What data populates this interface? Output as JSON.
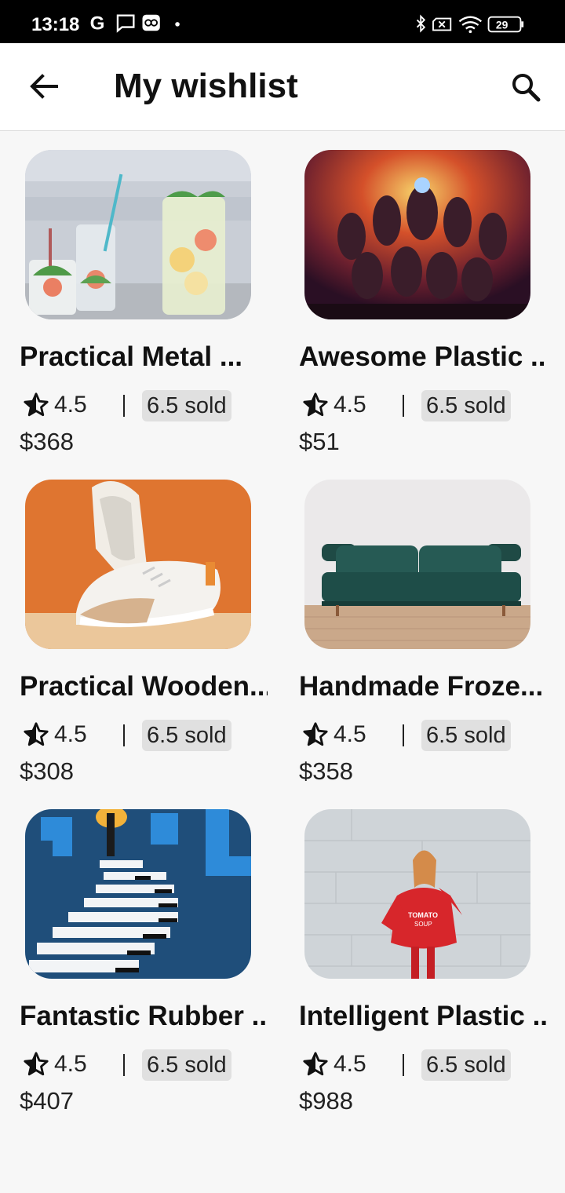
{
  "status_bar": {
    "time": "13:18",
    "left_icons": [
      "google-icon",
      "message-icon",
      "link-icon",
      "dot-icon"
    ],
    "right_icons": [
      "bluetooth-icon",
      "no-sim-icon",
      "wifi-icon",
      "battery-icon"
    ],
    "battery_level": "29"
  },
  "header": {
    "title": "My wishlist"
  },
  "products": [
    {
      "name": "Practical Metal ...",
      "rating": "4.5",
      "sold": "6.5 sold",
      "price": "$368",
      "image": "drinks-photo"
    },
    {
      "name": "Awesome Plastic ...",
      "rating": "4.5",
      "sold": "6.5 sold",
      "price": "$51",
      "image": "movie-poster-photo"
    },
    {
      "name": "Practical Wooden...",
      "rating": "4.5",
      "sold": "6.5 sold",
      "price": "$308",
      "image": "sneaker-photo"
    },
    {
      "name": "Handmade Froze...",
      "rating": "4.5",
      "sold": "6.5 sold",
      "price": "$358",
      "image": "sofa-photo"
    },
    {
      "name": "Fantastic Rubber ...",
      "rating": "4.5",
      "sold": "6.5 sold",
      "price": "$407",
      "image": "piano-stairs-photo"
    },
    {
      "name": "Intelligent Plastic ...",
      "rating": "4.5",
      "sold": "6.5 sold",
      "price": "$988",
      "image": "red-sweater-photo"
    }
  ]
}
